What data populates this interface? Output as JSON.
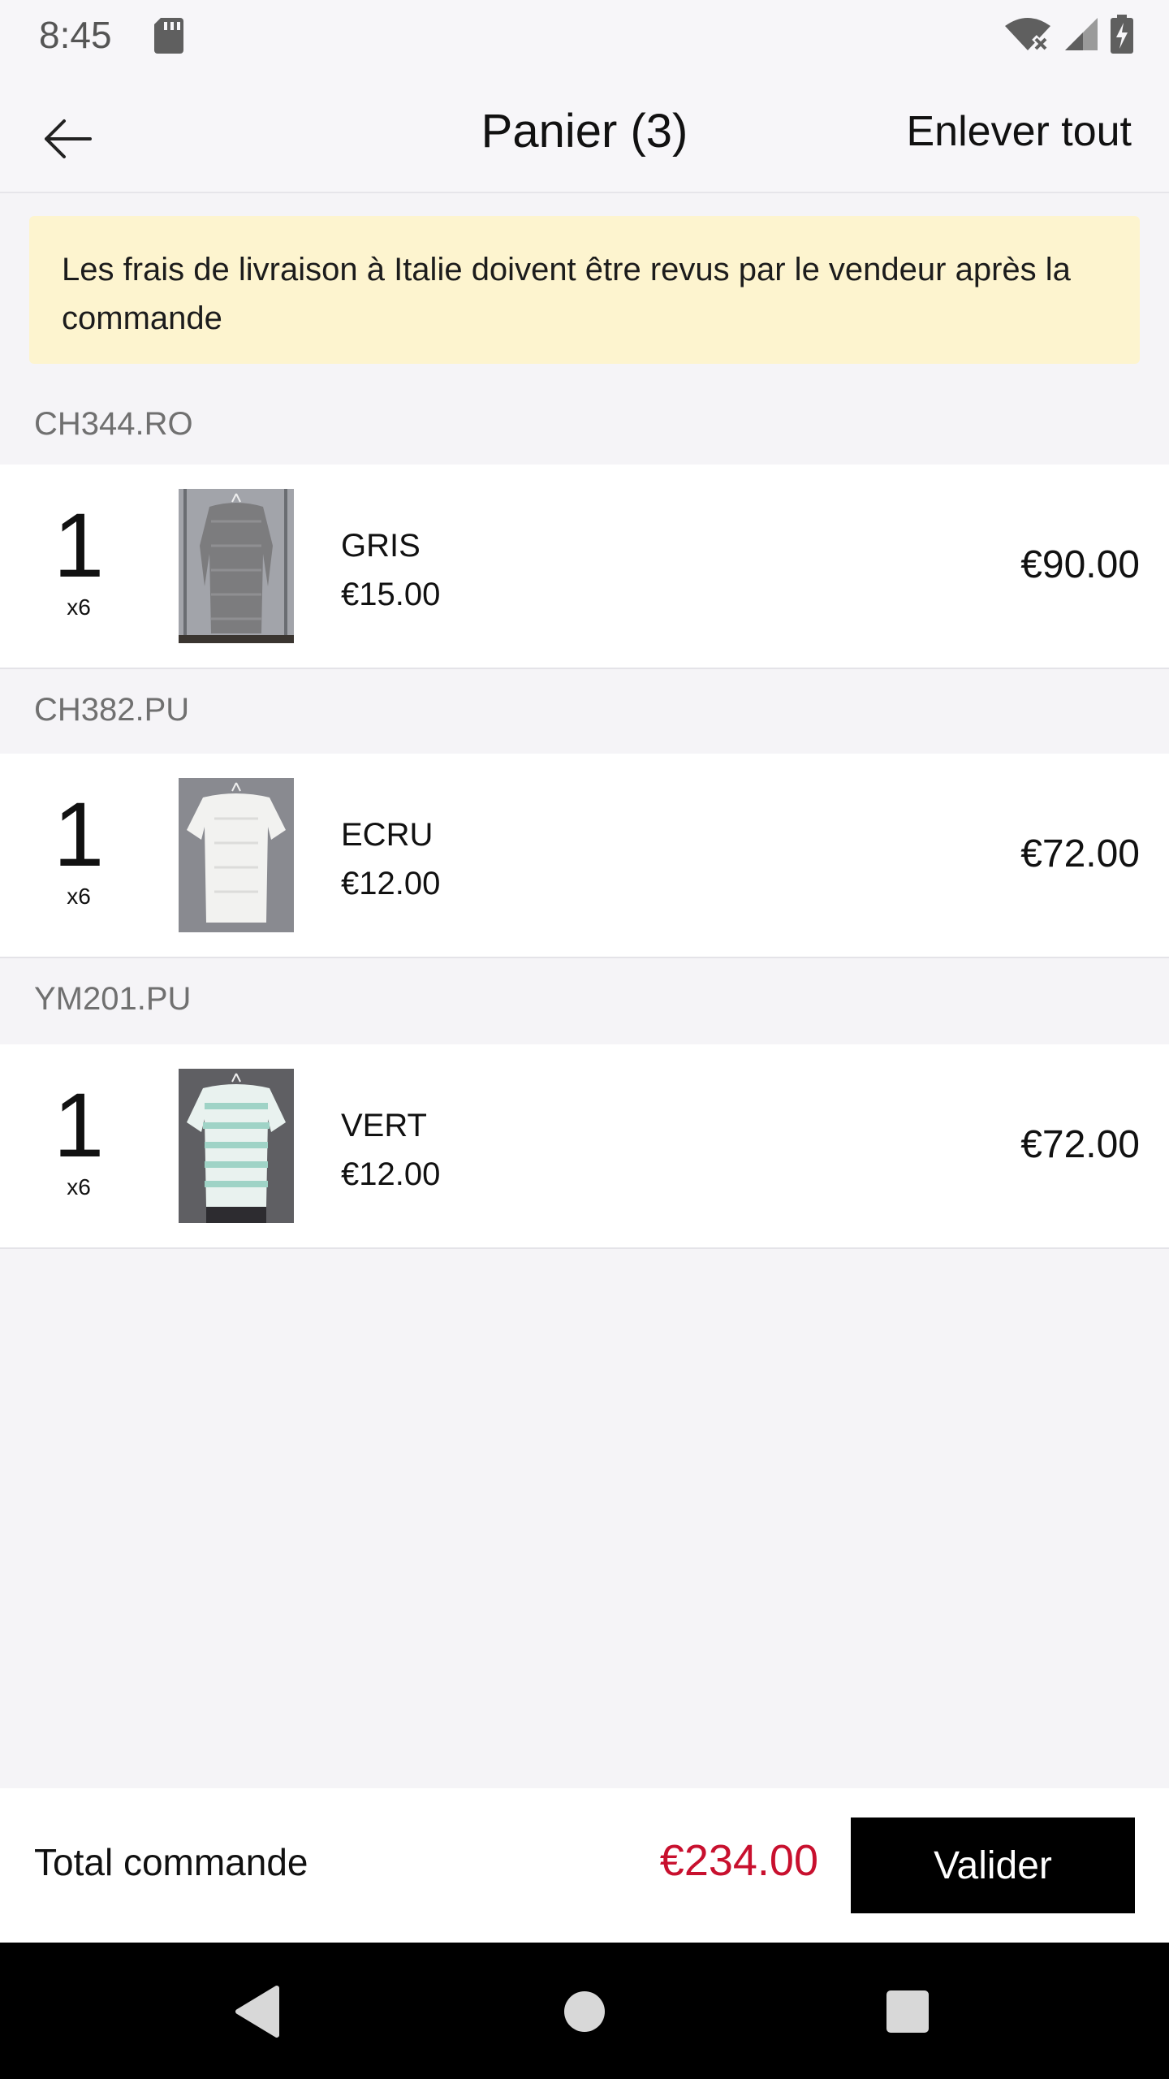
{
  "status_bar": {
    "time": "8:45"
  },
  "header": {
    "title": "Panier (3)",
    "remove_all": "Enlever tout",
    "back_icon": "arrow-left-icon"
  },
  "banner": {
    "text": "Les frais de livraison à Italie doivent être revus par le vendeur après la commande"
  },
  "cart_groups": [
    {
      "reference": "CH344.RO",
      "item": {
        "quantity": "1",
        "multiplier": "x6",
        "color": "GRIS",
        "unit_price": "€15.00",
        "total": "€90.00"
      }
    },
    {
      "reference": "CH382.PU",
      "item": {
        "quantity": "1",
        "multiplier": "x6",
        "color": "ECRU",
        "unit_price": "€12.00",
        "total": "€72.00"
      }
    },
    {
      "reference": "YM201.PU",
      "item": {
        "quantity": "1",
        "multiplier": "x6",
        "color": "VERT",
        "unit_price": "€12.00",
        "total": "€72.00"
      }
    }
  ],
  "footer": {
    "total_label": "Total commande",
    "total_value": "€234.00",
    "validate_label": "Valider"
  },
  "colors": {
    "accent_price": "#c8102e",
    "banner_bg": "#fdf4cf",
    "button_bg": "#000000"
  }
}
